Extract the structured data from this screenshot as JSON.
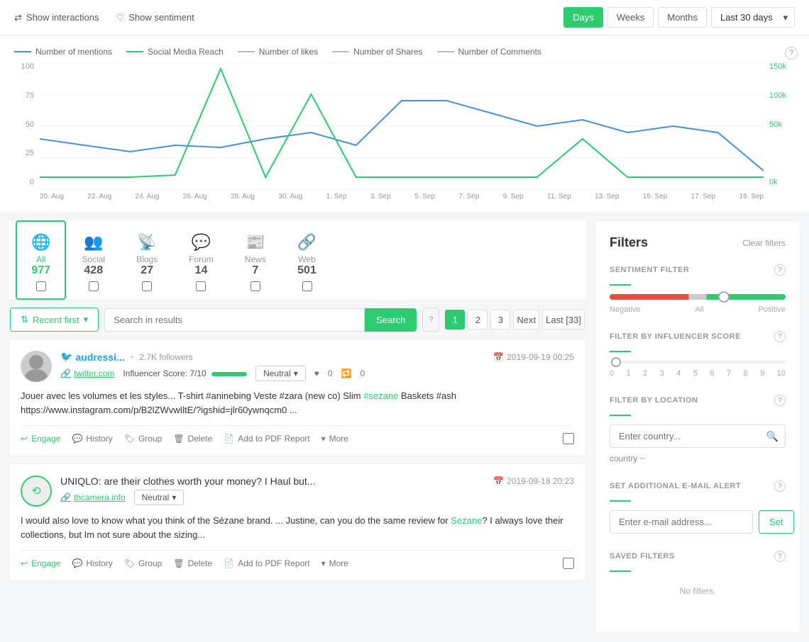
{
  "toolbar": {
    "show_interactions": "Show interactions",
    "show_sentiment": "Show sentiment",
    "periods": [
      "Days",
      "Weeks",
      "Months"
    ],
    "active_period": "Days",
    "date_range": "Last 30 days",
    "help": "?"
  },
  "chart": {
    "left_axis": [
      "100",
      "75",
      "50",
      "25",
      "0"
    ],
    "right_axis": [
      "150k",
      "100k",
      "50k",
      "0k"
    ],
    "x_labels": [
      "20. Aug",
      "22. Aug",
      "24. Aug",
      "26. Aug",
      "28. Aug",
      "30. Aug",
      "1. Sep",
      "3. Sep",
      "5. Sep",
      "7. Sep",
      "9. Sep",
      "11. Sep",
      "13. Sep",
      "15. Sep",
      "17. Sep",
      "19. Sep"
    ],
    "legend": [
      {
        "label": "Number of mentions",
        "color": "#4a90d9"
      },
      {
        "label": "Social Media Reach",
        "color": "#2ecc71"
      },
      {
        "label": "Number of likes",
        "color": "#bbb"
      },
      {
        "label": "Number of Shares",
        "color": "#bbb"
      },
      {
        "label": "Number of Comments",
        "color": "#bbb"
      }
    ]
  },
  "source_tabs": [
    {
      "id": "all",
      "label": "All",
      "count": "977",
      "active": true,
      "icon": "🌐"
    },
    {
      "id": "social",
      "label": "Social",
      "count": "428",
      "active": false,
      "icon": "👥"
    },
    {
      "id": "blogs",
      "label": "Blogs",
      "count": "27",
      "active": false,
      "icon": "📡"
    },
    {
      "id": "forum",
      "label": "Forum",
      "count": "14",
      "active": false,
      "icon": "💬"
    },
    {
      "id": "news",
      "label": "News",
      "count": "7",
      "active": false,
      "icon": "📰"
    },
    {
      "id": "web",
      "label": "Web",
      "count": "501",
      "active": false,
      "icon": "🔗"
    }
  ],
  "results_toolbar": {
    "sort_label": "Recent first",
    "search_placeholder": "Search in results",
    "search_btn": "Search",
    "help": "?",
    "pages": [
      "1",
      "2",
      "3"
    ],
    "next": "Next",
    "last": "Last [33]"
  },
  "posts": [
    {
      "id": "post1",
      "avatar_type": "image",
      "username": "audressi...",
      "platform_icon": "🐦",
      "followers": "2.7K followers",
      "source": "twitter.com",
      "date": "2019-09-19 00:25",
      "influencer_score": "7/10",
      "score_pct": 70,
      "sentiment": "Neutral",
      "likes": "0",
      "retweets": "0",
      "text": "Jouer avec les volumes et les styles... T-shirt #aninebing Veste #zara (new co) Slim #sezane Baskets #ash https://www.instagram.com/p/B2lZWvwIltE/?igshid=jlr60ywnqcm0 ...",
      "sezane_link": "#sezane",
      "actions": [
        "Engage",
        "History",
        "Group",
        "Delete",
        "Add to PDF Report",
        "More"
      ]
    },
    {
      "id": "post2",
      "avatar_type": "share",
      "username": "",
      "platform_icon": "",
      "followers": "",
      "source": "thcamera.info",
      "date": "2019-09-18 20:23",
      "influencer_score": "",
      "sentiment": "Neutral",
      "title": "UNIQLO: are their clothes worth your money? I Haul but...",
      "text": "I would also love to know what you think of the Sézane brand. ... Justine, can you do the same review for Sezane? I always love their collections, but Im not sure about the sizing...",
      "sezane_link": "Sezane",
      "actions": [
        "Engage",
        "History",
        "Group",
        "Delete",
        "Add to PDF Report",
        "More"
      ]
    }
  ],
  "filters": {
    "title": "Filters",
    "clear_btn": "Clear filters",
    "sentiment": {
      "label": "SENTIMENT FILTER",
      "negative": "Negative",
      "all": "All",
      "positive": "Positive",
      "help": "?"
    },
    "influencer": {
      "label": "FILTER BY INFLUENCER SCORE",
      "min": "0",
      "max": "10",
      "ticks": [
        "0",
        "1",
        "2",
        "3",
        "4",
        "5",
        "6",
        "7",
        "8",
        "9",
        "10"
      ],
      "help": "?"
    },
    "location": {
      "label": "FILTER BY LOCATION",
      "placeholder": "Enter country...",
      "country_note": "country ~",
      "help": "?"
    },
    "email": {
      "label": "SET ADDITIONAL E-MAIL ALERT",
      "placeholder": "Enter e-mail address...",
      "set_btn": "Set",
      "help": "?"
    },
    "saved": {
      "label": "SAVED FILTERS",
      "none_text": "No filters.",
      "help": "?"
    }
  }
}
